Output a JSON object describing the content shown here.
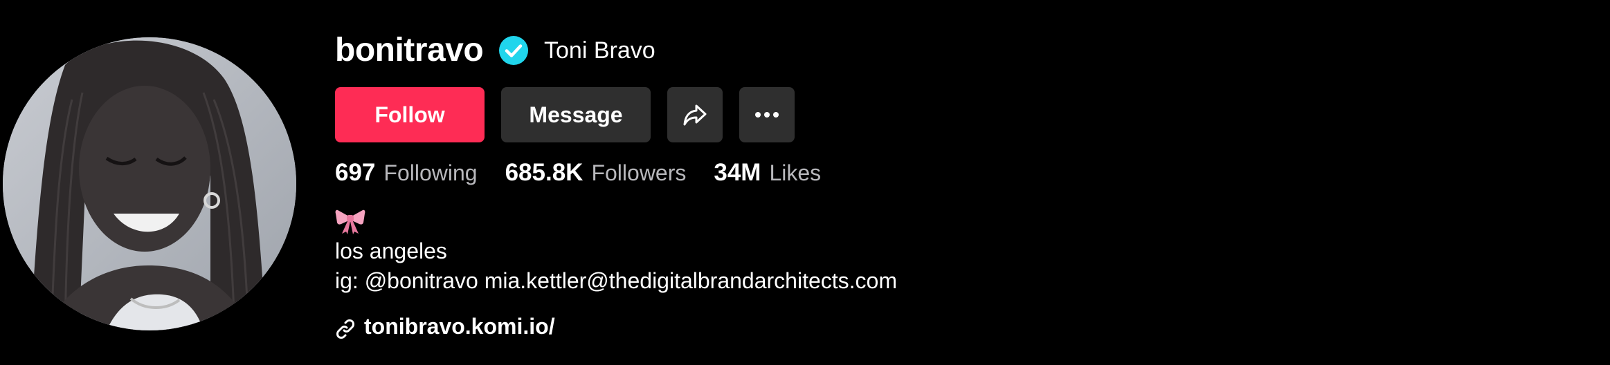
{
  "profile": {
    "username": "bonitravo",
    "display_name": "Toni Bravo",
    "verified": true,
    "avatar_alt": "profile photo"
  },
  "actions": {
    "follow_label": "Follow",
    "message_label": "Message",
    "share_icon": "share-icon",
    "more_icon": "more-dots-icon"
  },
  "stats": [
    {
      "value": "697",
      "label": "Following"
    },
    {
      "value": "685.8K",
      "label": "Followers"
    },
    {
      "value": "34M",
      "label": "Likes"
    }
  ],
  "bio": {
    "emoji": "🎀",
    "lines": [
      "los angeles",
      "ig: @bonitravo mia.kettler@thedigitalbrandarchitects.com"
    ]
  },
  "link": {
    "icon": "link-icon",
    "text": "tonibravo.komi.io/"
  },
  "colors": {
    "background": "#000000",
    "follow_button": "#fe2c55",
    "secondary_button": "#2f2f2f",
    "verified_badge": "#20d5ec",
    "muted_text": "#b8b8bc"
  }
}
